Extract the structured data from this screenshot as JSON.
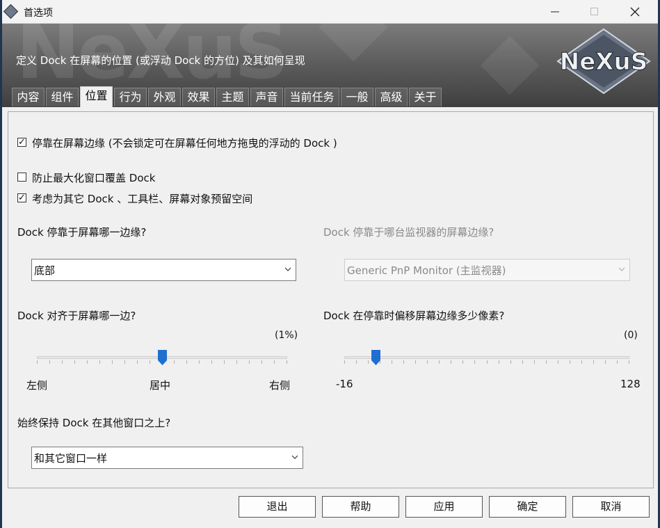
{
  "window": {
    "title": "首选项"
  },
  "banner": {
    "subtitle": "定义 Dock 在屏幕的位置 (或浮动 Dock 的方位) 及其如何呈现",
    "logo_text": "NeXuS",
    "watermark": "NeXuS"
  },
  "tabs": [
    {
      "label": "内容",
      "active": false
    },
    {
      "label": "组件",
      "active": false
    },
    {
      "label": "位置",
      "active": true
    },
    {
      "label": "行为",
      "active": false
    },
    {
      "label": "外观",
      "active": false
    },
    {
      "label": "效果",
      "active": false
    },
    {
      "label": "主题",
      "active": false
    },
    {
      "label": "声音",
      "active": false
    },
    {
      "label": "当前任务",
      "active": false
    },
    {
      "label": "一般",
      "active": false
    },
    {
      "label": "高级",
      "active": false
    },
    {
      "label": "关于",
      "active": false
    }
  ],
  "options": {
    "dock_to_edge": {
      "label": "停靠在屏幕边缘 (不会锁定可在屏幕任何地方拖曳的浮动的 Dock )",
      "checked": true
    },
    "prevent_maximize": {
      "label": "防止最大化窗口覆盖 Dock",
      "checked": false
    },
    "reserve_space": {
      "label": "考虑为其它 Dock 、工具栏、屏幕对象预留空间",
      "checked": true
    }
  },
  "edge": {
    "question": "Dock 停靠于屏幕哪一边缘?",
    "value": "底部"
  },
  "monitor": {
    "question": "Dock 停靠于哪台监视器的屏幕边缘?",
    "value": "Generic PnP Monitor (主监视器)"
  },
  "align": {
    "question": "Dock 对齐于屏幕哪一边?",
    "readout": "(1%)",
    "position": 0.5,
    "left_label": "左侧",
    "center_label": "居中",
    "right_label": "右侧"
  },
  "offset": {
    "question": "Dock 在停靠时偏移屏幕边缘多少像素?",
    "readout": "(0)",
    "min": -16,
    "max": 128,
    "value": 0,
    "min_label": "-16",
    "max_label": "128"
  },
  "ontop": {
    "question": "始终保持 Dock 在其他窗口之上?",
    "value": "和其它窗口一样"
  },
  "buttons": {
    "exit": "退出",
    "help": "帮助",
    "apply": "应用",
    "ok": "确定",
    "cancel": "取消"
  },
  "colors": {
    "accent_thumb": "#1f6fd1",
    "banner_dark": "#3f3f3f"
  }
}
